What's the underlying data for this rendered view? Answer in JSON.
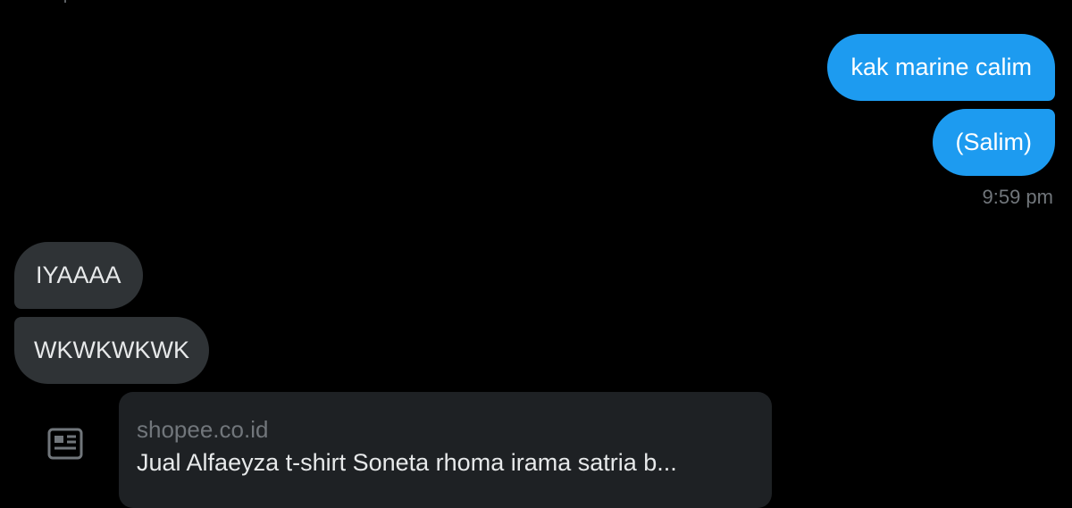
{
  "messages": {
    "sent": [
      {
        "text": "kak marine calim"
      },
      {
        "text": "(Salim)"
      }
    ],
    "sent_timestamp": "9:59 pm",
    "received": [
      {
        "text": "IYAAAA"
      },
      {
        "text": "WKWKWKWK"
      }
    ]
  },
  "link_card": {
    "icon": "article-icon",
    "domain": "shopee.co.id",
    "title": "Jual Alfaeyza t-shirt Soneta rhoma irama satria b..."
  },
  "colors": {
    "background": "#000000",
    "sent_bubble": "#1d9bf0",
    "received_bubble": "#2f3336",
    "link_card": "#1e2124",
    "muted_text": "#71767b",
    "primary_text": "#e7e9ea"
  }
}
